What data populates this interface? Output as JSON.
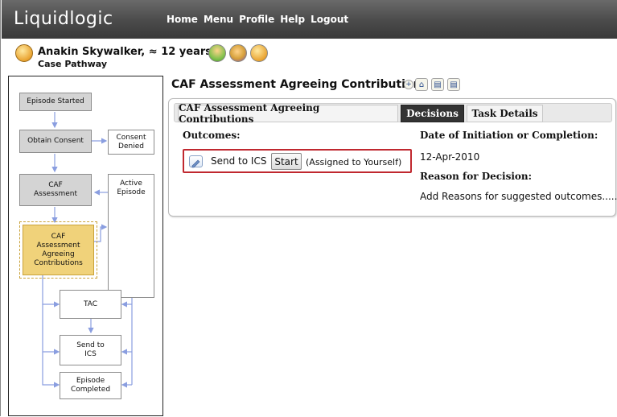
{
  "app": {
    "logo_text": "Liquidlogic",
    "nav": [
      "Home",
      "Menu",
      "Profile",
      "Help",
      "Logout"
    ]
  },
  "patient": {
    "name": "Anakin Skywalker, ≈ 12 years",
    "subtitle": "Case Pathway"
  },
  "pathway": {
    "nodes": {
      "episode_started": "Episode Started",
      "obtain_consent": "Obtain Consent",
      "consent_denied": "Consent\nDenied",
      "caf_assessment": "CAF\nAssessment",
      "active_episode": "Active\nEpisode",
      "caf_agreeing": "CAF\nAssessment\nAgreeing\nContributions",
      "tac": "TAC",
      "send_to_ics": "Send to\nICS",
      "episode_completed": "Episode\nCompleted"
    }
  },
  "main": {
    "title": "CAF Assessment Agreeing Contributions",
    "tabs": [
      {
        "label": "CAF Assessment Agreeing Contributions",
        "selected": false
      },
      {
        "label": "Decisions",
        "selected": true
      },
      {
        "label": "Task Details",
        "selected": false
      }
    ],
    "outcomes_label": "Outcomes:",
    "outcome": {
      "text": "Send to ICS",
      "button": "Start",
      "assigned": "(Assigned to Yourself)"
    },
    "date_label": "Date of Initiation or Completion:",
    "date_value": "12-Apr-2010",
    "reason_label": "Reason for Decision:",
    "reason_value": "Add Reasons for suggested outcomes......"
  },
  "icons": {
    "toolbar": [
      "expand-icon",
      "home-icon",
      "document-icon",
      "document-alt-icon"
    ],
    "patient": [
      "patient-icon",
      "person-icon",
      "group-icon",
      "case-icon"
    ]
  },
  "colors": {
    "highlight_border": "#c0282f",
    "selected_tab": "#333333",
    "active_node": "#f0d27a"
  }
}
